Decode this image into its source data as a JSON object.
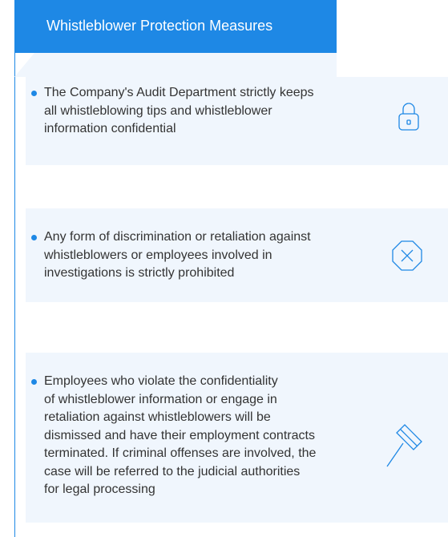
{
  "header": {
    "title": "Whistleblower Protection Measures"
  },
  "items": [
    {
      "text": "The Company's Audit Department strictly keeps\nall whistleblowing tips and whistleblower\ninformation confidential",
      "icon": "lock-icon"
    },
    {
      "text": "Any form of discrimination or retaliation against\nwhistleblowers or employees involved in\ninvestigations is strictly prohibited",
      "icon": "prohibited-x-icon"
    },
    {
      "text": "Employees who violate the confidentiality\nof whistleblower information or engage in\nretaliation against whistleblowers will be\ndismissed and have their employment contracts\nterminated. If criminal offenses are involved, the\ncase will be referred to the judicial authorities\nfor legal processing",
      "icon": "gavel-icon"
    }
  ],
  "colors": {
    "accent": "#1e88e5",
    "card_background": "#f0f6fd",
    "text": "#333333"
  }
}
